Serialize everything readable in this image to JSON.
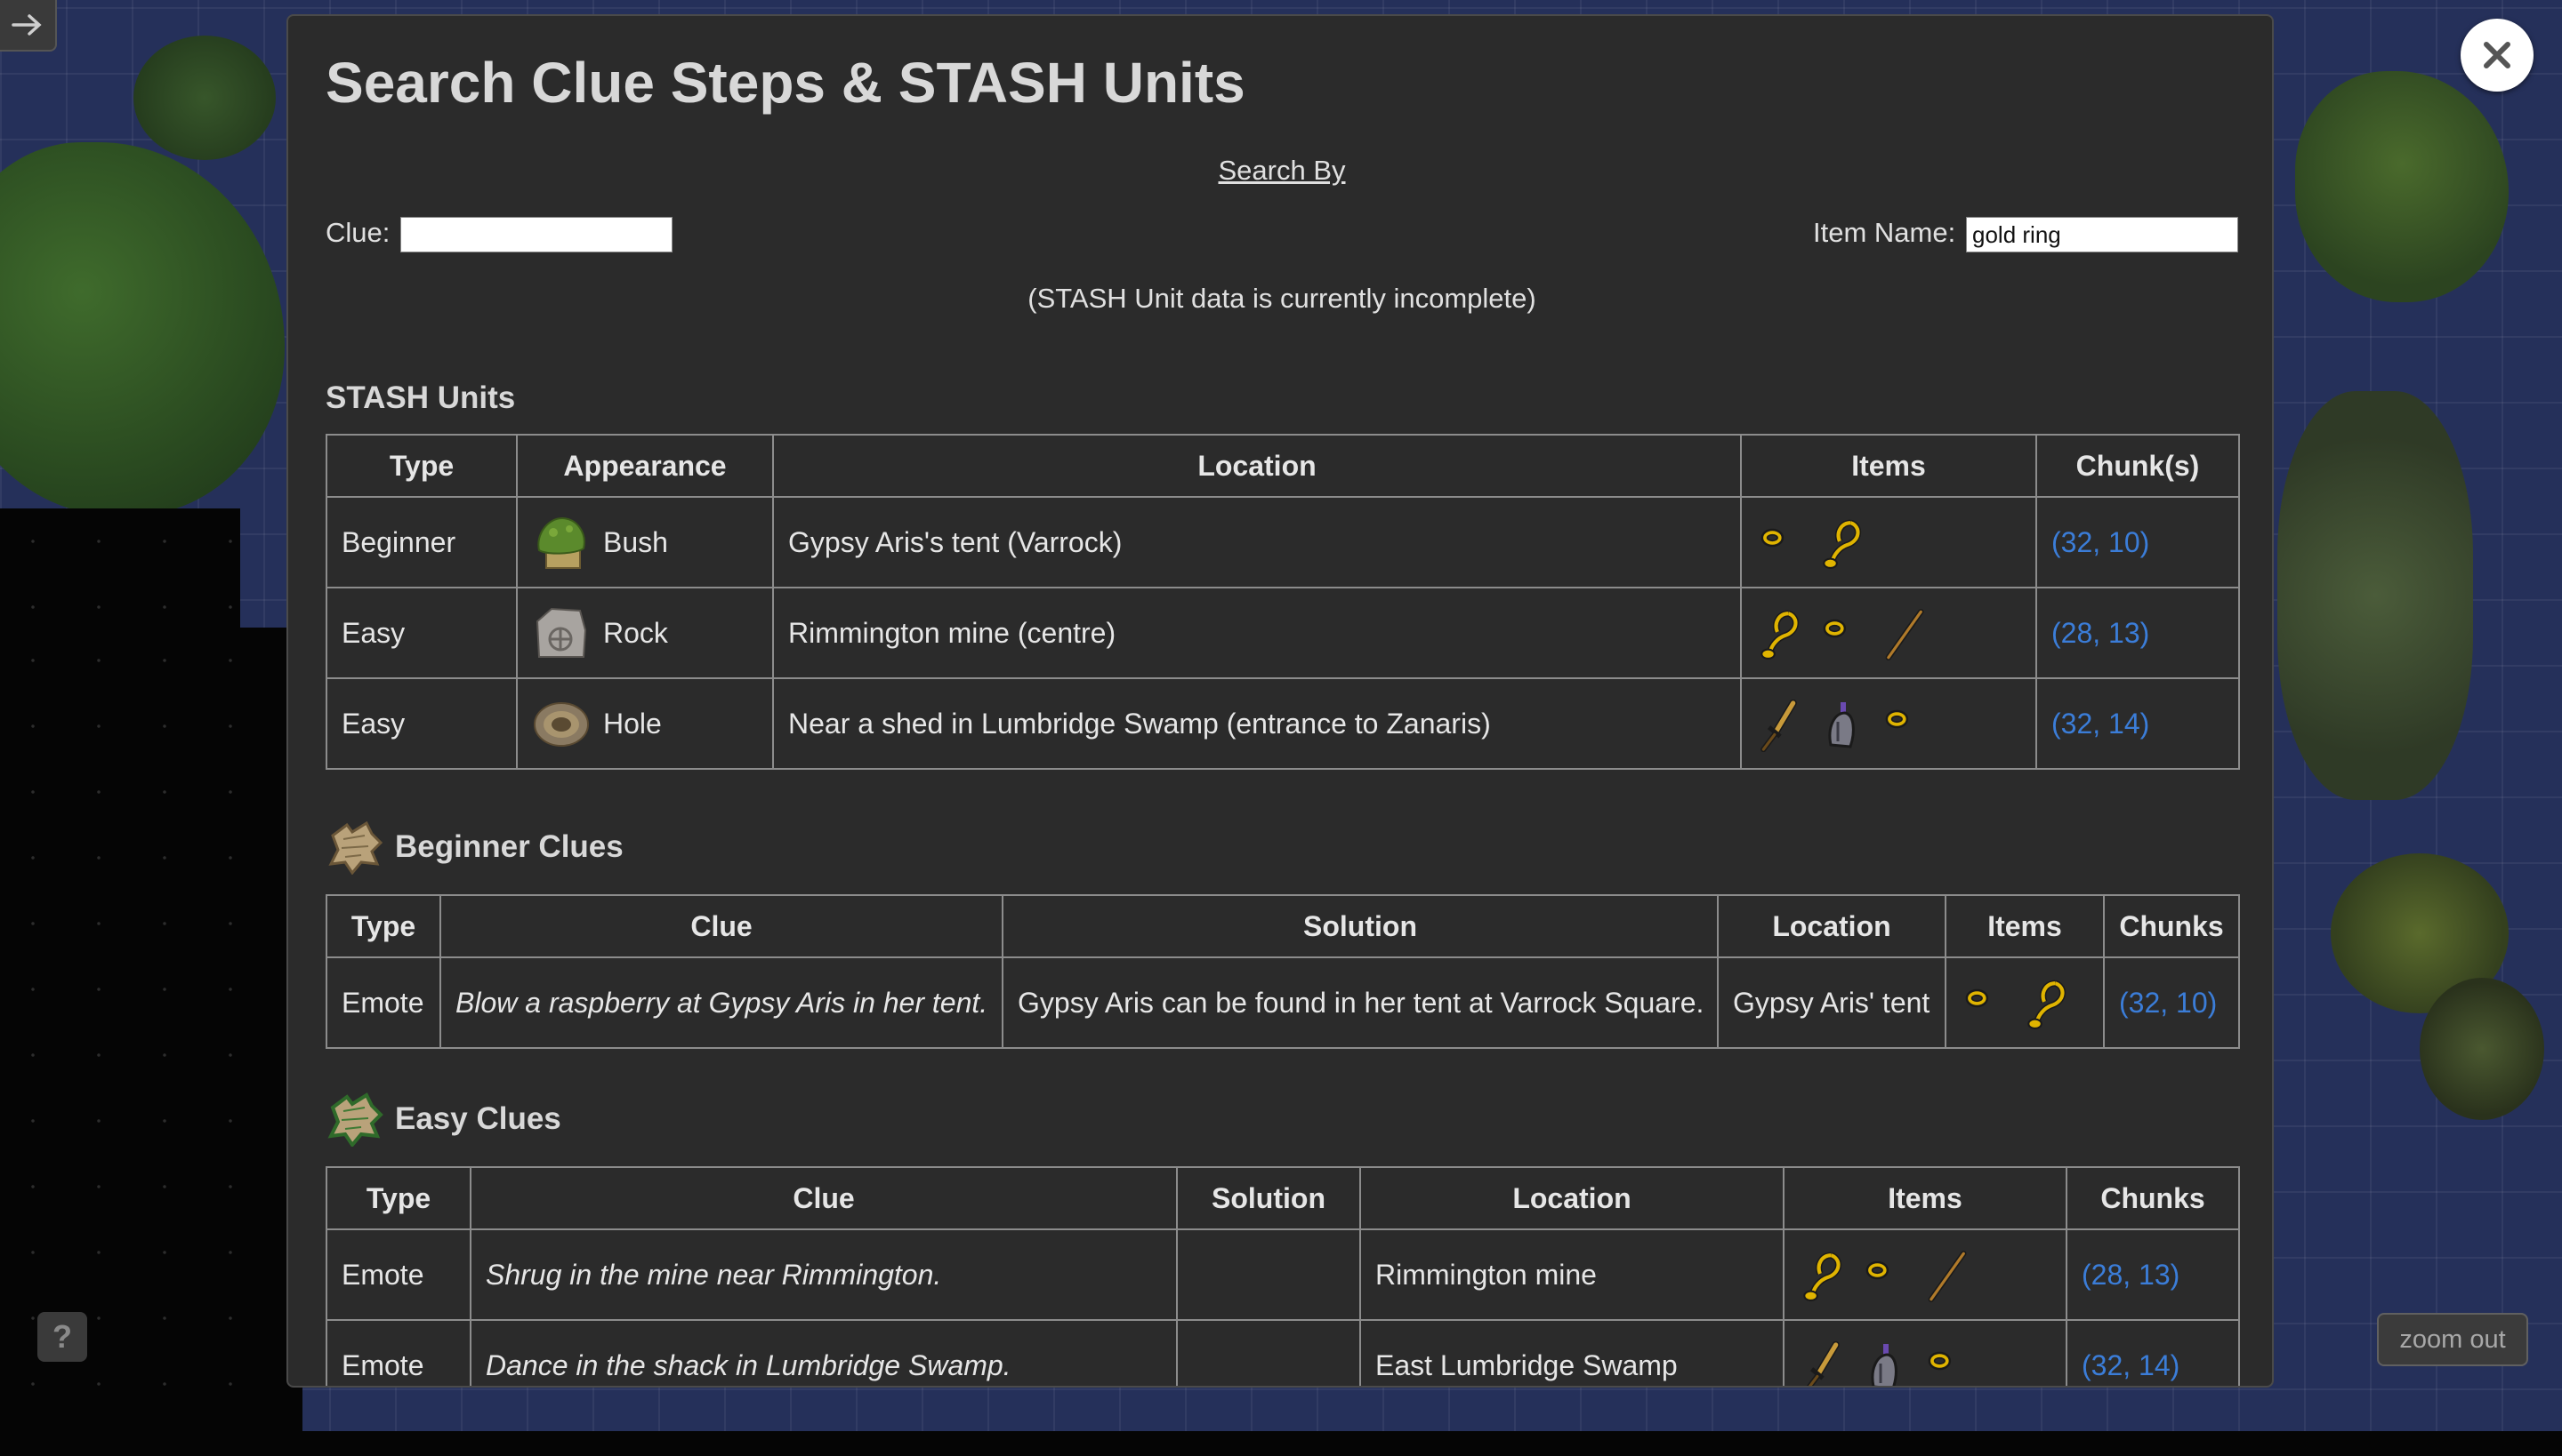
{
  "map_controls": {
    "corner_icon": "arrow-right-icon",
    "help_label": "?",
    "zoom_out_label": "zoom out"
  },
  "modal": {
    "title": "Search Clue Steps & STASH Units",
    "close_icon": "close-icon",
    "search_by_label": "Search By",
    "clue_label": "Clue:",
    "clue_value": "",
    "item_name_label": "Item Name:",
    "item_name_value": "gold ring",
    "note": "(STASH Unit data is currently incomplete)"
  },
  "stash": {
    "title": "STASH Units",
    "headers": [
      "Type",
      "Appearance",
      "Location",
      "Items",
      "Chunk(s)"
    ],
    "rows": [
      {
        "type": "Beginner",
        "appearance": "Bush",
        "appearance_icon": "bush-icon",
        "location": "Gypsy Aris's tent (Varrock)",
        "items": [
          "gold-ring-icon",
          "gold-necklace-icon"
        ],
        "chunks": "(32, 10)"
      },
      {
        "type": "Easy",
        "appearance": "Rock",
        "appearance_icon": "rock-icon",
        "location": "Rimmington mine (centre)",
        "items": [
          "gold-necklace-icon",
          "gold-ring-icon",
          "bronze-pickaxe-icon"
        ],
        "chunks": "(28, 13)"
      },
      {
        "type": "Easy",
        "appearance": "Hole",
        "appearance_icon": "hole-icon",
        "location": "Near a shed in Lumbridge Swamp (entrance to Zanaris)",
        "items": [
          "bronze-dagger-icon",
          "iron-med-helm-icon",
          "gold-ring-icon"
        ],
        "chunks": "(32, 14)"
      }
    ]
  },
  "beginner": {
    "title": "Beginner Clues",
    "icon": "beginner-clue-scroll-icon",
    "headers": [
      "Type",
      "Clue",
      "Solution",
      "Location",
      "Items",
      "Chunks"
    ],
    "rows": [
      {
        "type": "Emote",
        "clue": "Blow a raspberry at Gypsy Aris in her tent.",
        "solution": "Gypsy Aris can be found in her tent at Varrock Square.",
        "location": "Gypsy Aris' tent",
        "items": [
          "gold-ring-icon",
          "gold-necklace-icon"
        ],
        "chunks": "(32, 10)"
      }
    ]
  },
  "easy": {
    "title": "Easy Clues",
    "icon": "easy-clue-scroll-icon",
    "headers": [
      "Type",
      "Clue",
      "Solution",
      "Location",
      "Items",
      "Chunks"
    ],
    "rows": [
      {
        "type": "Emote",
        "clue": "Shrug in the mine near Rimmington.",
        "solution": "",
        "location": "Rimmington mine",
        "items": [
          "gold-necklace-icon",
          "gold-ring-icon",
          "bronze-pickaxe-icon"
        ],
        "chunks": "(28, 13)"
      },
      {
        "type": "Emote",
        "clue": "Dance in the shack in Lumbridge Swamp.",
        "solution": "",
        "location": "East Lumbridge Swamp",
        "items": [
          "bronze-dagger-icon",
          "iron-med-helm-icon",
          "gold-ring-icon"
        ],
        "chunks": "(32, 14)"
      }
    ]
  }
}
